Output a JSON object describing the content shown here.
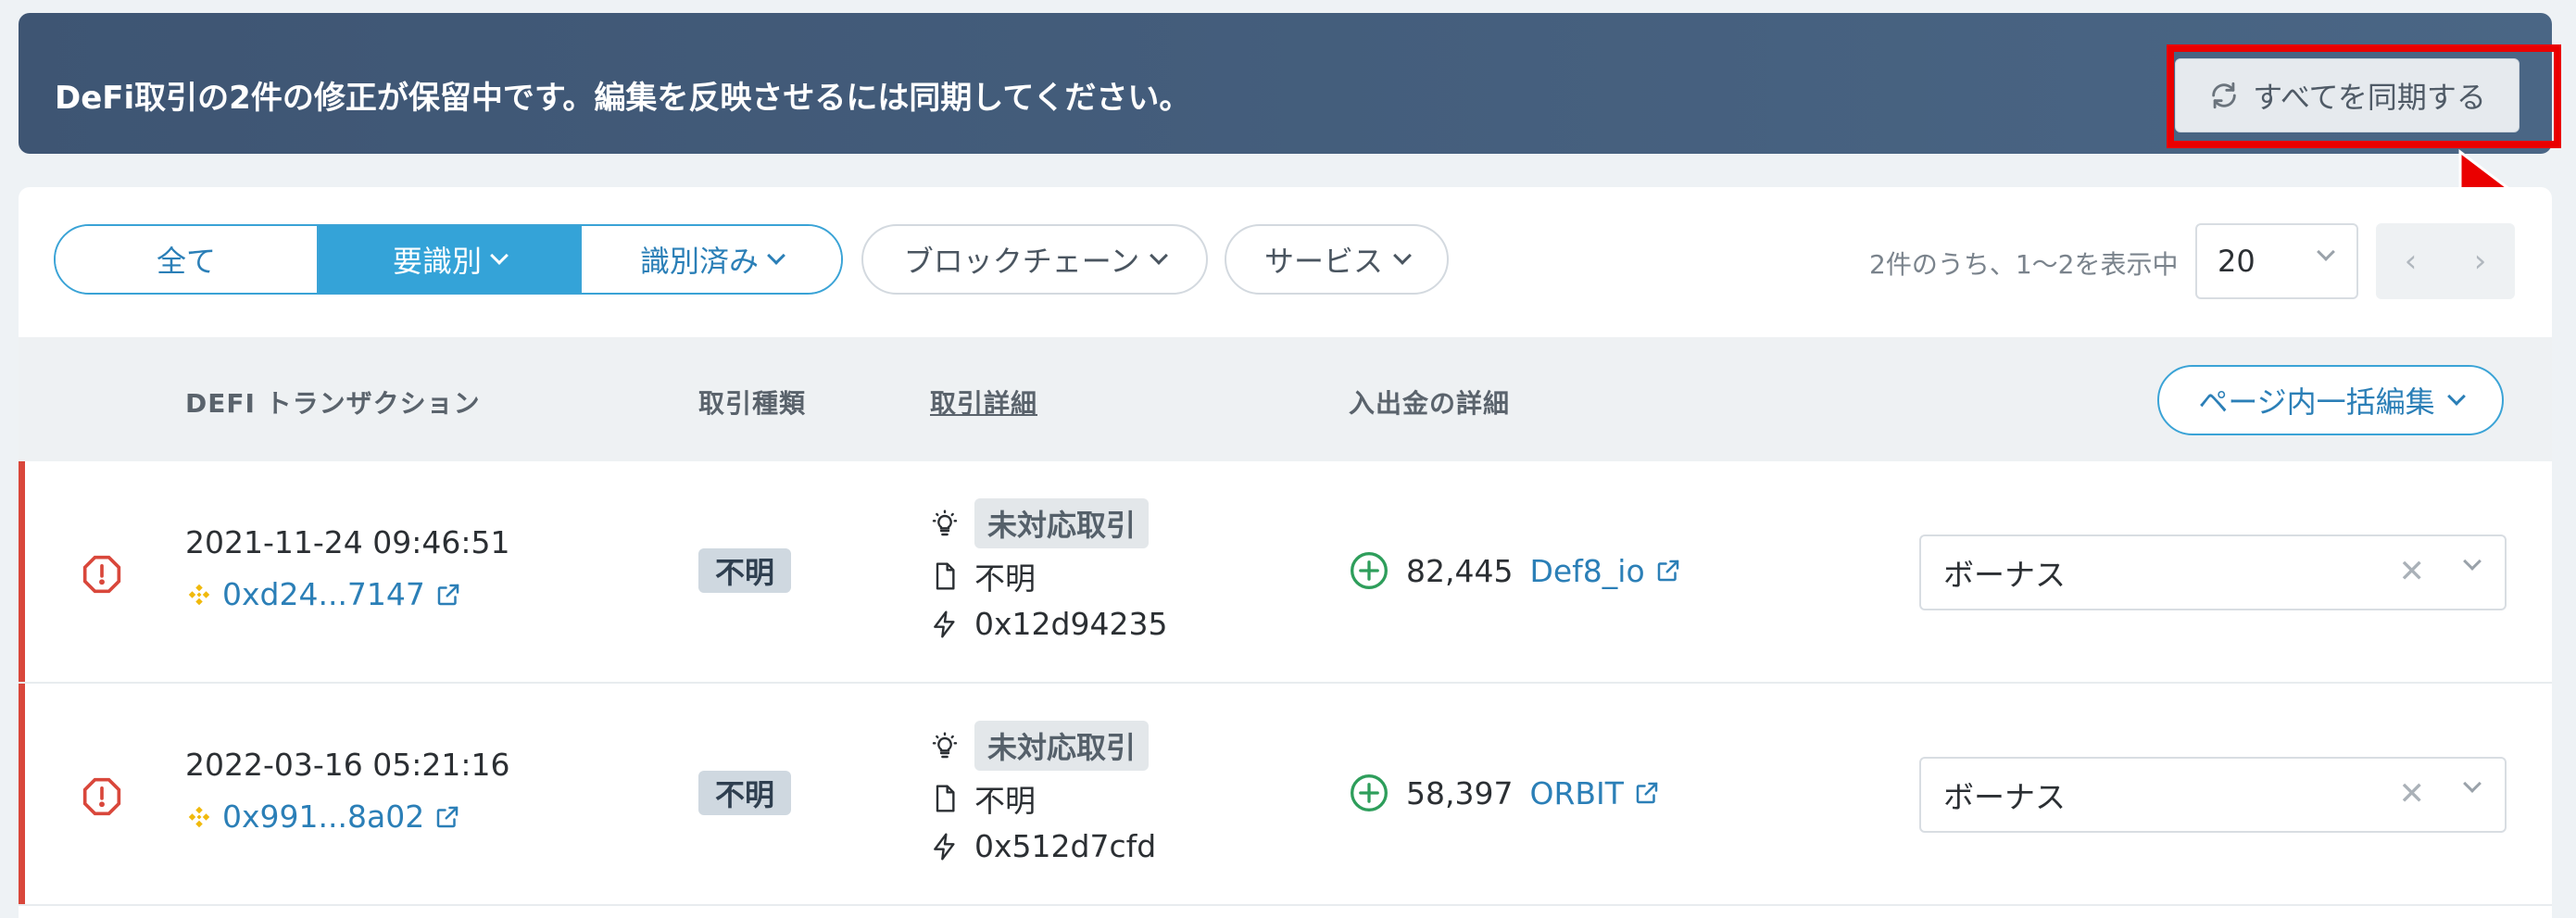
{
  "banner": {
    "message": "DeFi取引の2件の修正が保留中です。編集を反映させるには同期してください。",
    "sync_label": "すべてを同期する"
  },
  "filters": {
    "segments": [
      "全て",
      "要識別",
      "識別済み"
    ],
    "active_segment": "要識別",
    "blockchain_label": "ブロックチェーン",
    "service_label": "サービス"
  },
  "pagination": {
    "count_text": "2件のうち、1〜2を表示中",
    "page_size": "20",
    "prev": "‹",
    "next": "›"
  },
  "table": {
    "headers": {
      "tx": "DEFI トランザクション",
      "type": "取引種類",
      "details": "取引詳細",
      "flow": "入出金の詳細"
    },
    "bulk_edit_label": "ページ内一括編集",
    "rows": [
      {
        "date": "2021-11-24 09:46:51",
        "hash": "0xd24...7147",
        "type": "不明",
        "tag": "未対応取引",
        "doc": "不明",
        "method": "0x12d94235",
        "amount": "82,445",
        "counterparty": "Def8_io",
        "category": "ボーナス"
      },
      {
        "date": "2022-03-16 05:21:16",
        "hash": "0x991...8a02",
        "type": "不明",
        "tag": "未対応取引",
        "doc": "不明",
        "method": "0x512d7cfd",
        "amount": "58,397",
        "counterparty": "ORBIT",
        "category": "ボーナス"
      }
    ]
  },
  "colors": {
    "banner": "#435d7c",
    "accent": "#34a3d8",
    "alert": "#d9473b",
    "positive": "#2e9e5b",
    "highlight": "#ea0000"
  }
}
